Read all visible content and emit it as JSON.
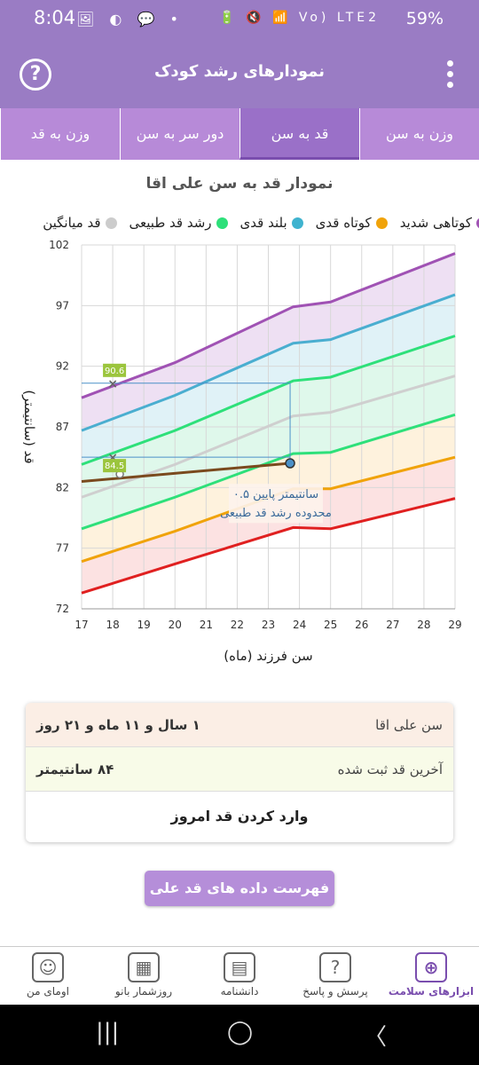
{
  "status": {
    "time": "8:04",
    "left_icons": "🖼 ◐ 💬 •",
    "right_icons": "🔋 🔇 📶 Vo) LTE2",
    "battery": "59%"
  },
  "appbar": {
    "title": "نمودارهای رشد کودک",
    "help_icon": "help-circle-icon",
    "menu_icon": "kebab-menu-icon"
  },
  "tabs": [
    {
      "label": "وزن به سن",
      "active": false
    },
    {
      "label": "قد به سن",
      "active": true
    },
    {
      "label": "دور سر به سن",
      "active": false
    },
    {
      "label": "وزن به قد",
      "active": false
    }
  ],
  "chart_title": "نمودار قد به سن علی اقا",
  "legend": [
    {
      "label": "کوتاهی شدید",
      "color": "#a052b4"
    },
    {
      "label": "کوتاه قدی",
      "color": "#f0a30a"
    },
    {
      "label": "بلند قدی",
      "color": "#3fb3cf"
    },
    {
      "label": "رشد قد طبیعی",
      "color": "#2ee07a"
    },
    {
      "label": "قد میانگین",
      "color": "#cccccc"
    }
  ],
  "chart_data": {
    "type": "line",
    "xlabel": "سن فرزند (ماه)",
    "ylabel": "قد (سانتیمتر)",
    "xlim": [
      17,
      29
    ],
    "ylim": [
      72,
      102
    ],
    "xticks": [
      17,
      18,
      19,
      20,
      21,
      22,
      23,
      24,
      25,
      26,
      27,
      28,
      29
    ],
    "yticks": [
      72,
      77,
      82,
      87,
      92,
      97,
      102
    ],
    "grid": true,
    "series": [
      {
        "color": "#a052b4",
        "x": [
          17,
          20,
          23.8,
          25,
          29
        ],
        "y": [
          89.4,
          92.3,
          96.9,
          97.3,
          101.3
        ]
      },
      {
        "color": "#4aaed0",
        "x": [
          17,
          20,
          23.8,
          25,
          29
        ],
        "y": [
          86.7,
          89.6,
          93.9,
          94.2,
          97.9
        ]
      },
      {
        "color": "#2ee07a",
        "x": [
          17,
          20,
          23.8,
          25,
          29
        ],
        "y": [
          83.9,
          86.7,
          90.8,
          91.1,
          94.5
        ]
      },
      {
        "color": "#cfcfcf",
        "x": [
          17,
          20,
          23.8,
          25,
          29
        ],
        "y": [
          81.2,
          83.9,
          87.9,
          88.2,
          91.2
        ]
      },
      {
        "color": "#2ee07a",
        "x": [
          17,
          20,
          23.8,
          25,
          29
        ],
        "y": [
          78.6,
          81.2,
          84.8,
          84.9,
          88.0
        ]
      },
      {
        "color": "#f0a30a",
        "x": [
          17,
          20,
          23.8,
          25,
          29
        ],
        "y": [
          75.9,
          78.4,
          81.9,
          81.9,
          84.5
        ]
      },
      {
        "color": "#e02020",
        "x": [
          17,
          20,
          23.8,
          25,
          29
        ],
        "y": [
          73.3,
          75.7,
          78.7,
          78.6,
          81.1
        ]
      }
    ],
    "bands": [
      {
        "color": "#e7d3ee",
        "upper": 0,
        "lower": 1
      },
      {
        "color": "#d3ecf4",
        "upper": 1,
        "lower": 2
      },
      {
        "color": "#d2f5e2",
        "upper": 2,
        "lower": 4
      },
      {
        "color": "#fdeccf",
        "upper": 4,
        "lower": 5
      },
      {
        "color": "#fbd6d6",
        "upper": 5,
        "lower": 6
      }
    ],
    "child": {
      "color": "#7a4a1e",
      "x": [
        17,
        23.7
      ],
      "y": [
        82.5,
        84.0
      ]
    },
    "markers": [
      {
        "x": 18,
        "y": 90.6,
        "label": "90.6"
      },
      {
        "x": 18,
        "y": 84.5,
        "label": "84.5"
      }
    ],
    "annotation": {
      "line1": "۰.۵ سانتیمتر پایین",
      "line2": "محدوده رشد قد طبیعی"
    }
  },
  "info": {
    "age_label": "سن علی اقا",
    "age_value": "۱ سال و ۱۱ ماه و ۲۱ روز",
    "height_label": "آخرین قد ثبت شده",
    "height_value": "۸۴ سانتیمتر",
    "enter_label": "وارد کردن قد امروز"
  },
  "list_button": "فهرست داده های قد علی اقا",
  "bottom_nav": [
    {
      "label": "ابزارهای سلامت",
      "icon": "⊕",
      "active": true
    },
    {
      "label": "پرسش و پاسخ",
      "icon": "?",
      "active": false
    },
    {
      "label": "دانشنامه",
      "icon": "▤",
      "active": false
    },
    {
      "label": "روزشمار بانو",
      "icon": "▦",
      "active": false
    },
    {
      "label": "اومای من",
      "icon": "☺",
      "active": false
    }
  ],
  "sysnav": {
    "recent": "|||",
    "home": "◯",
    "back": "〈"
  }
}
